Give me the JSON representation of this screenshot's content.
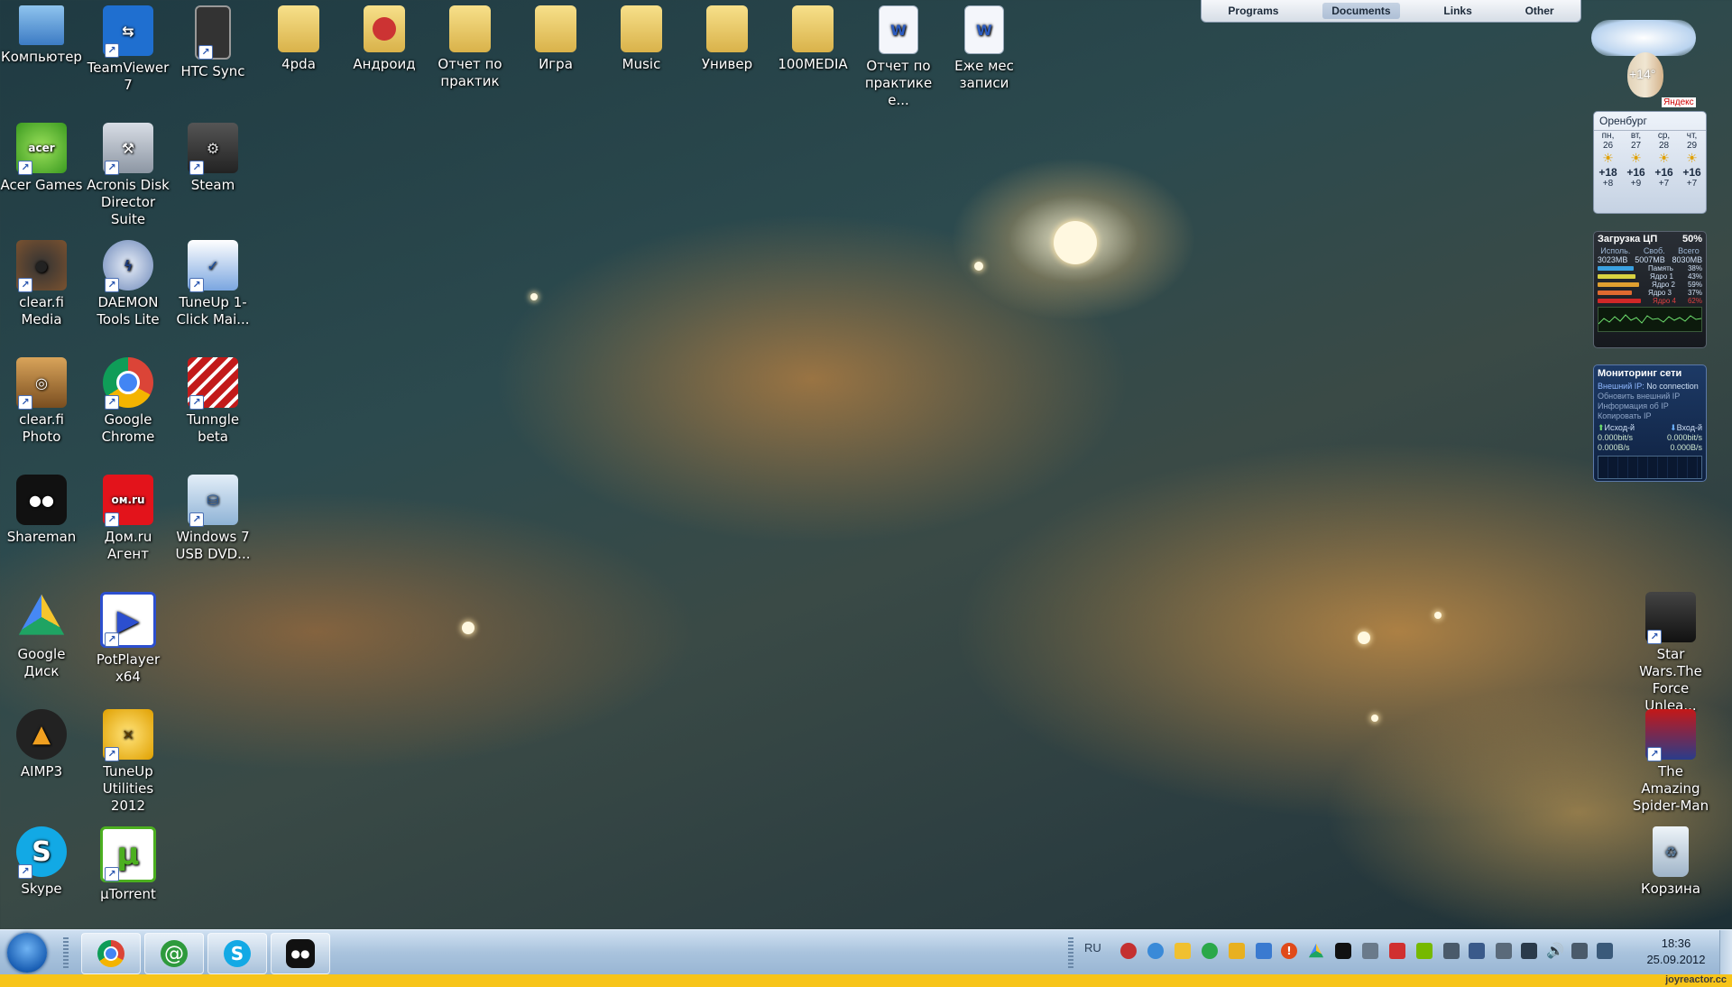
{
  "desktop_icons": {
    "computer": "Компьютер",
    "teamviewer": "TeamViewer 7",
    "htcsync": "HTC Sync",
    "fourpda": "4pda",
    "android": "Андроид",
    "report1": "Отчет по практик",
    "game": "Игра",
    "music": "Music",
    "univer": "Универ",
    "media100": "100MEDIA",
    "report2": "Отчет по практике е...",
    "monthly": "Еже мес записи",
    "acer": "Acer Games",
    "acronis": "Acronis Disk Director Suite",
    "steam": "Steam",
    "clearfimedia": "clear.fi Media",
    "daemon": "DAEMON Tools Lite",
    "tuneup1": "TuneUp 1-Click Mai...",
    "clearfiphoto": "clear.fi Photo",
    "chrome": "Google Chrome",
    "tunngle": "Tunngle beta",
    "shareman": "Shareman",
    "domru": "Дом.ru Агент",
    "win7usb": "Windows 7 USB DVD...",
    "gdisk": "Google Диск",
    "potplayer": "PotPlayer x64",
    "aimp": "AIMP3",
    "tuneup2012": "TuneUp Utilities 2012",
    "skype": "Skype",
    "utorrent": "µTorrent",
    "starwars": "Star Wars.The Force Unlea...",
    "spiderman": "The Amazing Spider-Man",
    "recycle": "Корзина"
  },
  "toolbar": {
    "items": [
      "Programs",
      "Documents",
      "Links",
      "Other"
    ],
    "active": "Documents"
  },
  "weather": {
    "temp_now": "+14°",
    "brand": "Яндекс",
    "city": "Оренбург",
    "days": [
      "пн,",
      "вт,",
      "ср,",
      "чт,"
    ],
    "dates": [
      "26",
      "27",
      "28",
      "29"
    ],
    "day_temps": [
      "+18",
      "+16",
      "+16",
      "+16"
    ],
    "night_temps": [
      "+8",
      "+9",
      "+7",
      "+7"
    ]
  },
  "cpu": {
    "title": "Загрузка ЦП",
    "percent": "50%",
    "col_used": "Исполь.",
    "col_free": "Своб.",
    "col_total": "Всего",
    "used": "3023MB",
    "free": "5007MB",
    "total": "8030MB",
    "rows": [
      {
        "label": "Память",
        "value": "38%"
      },
      {
        "label": "Ядро 1",
        "value": "43%"
      },
      {
        "label": "Ядро 2",
        "value": "59%"
      },
      {
        "label": "Ядро 3",
        "value": "37%"
      },
      {
        "label": "Ядро 4",
        "value": "62%"
      }
    ]
  },
  "net": {
    "title": "Мониторинг сети",
    "ip_label": "Внешний IP:",
    "ip_value": "No connection",
    "refresh": "Обновить внешний IP",
    "info": "Информация об IP",
    "copy": "Копировать IP",
    "out_label": "Исход-й",
    "in_label": "Вход-й",
    "out_bits": "0.000bit/s",
    "in_bits": "0.000bit/s",
    "out_bytes": "0.000B/s",
    "in_bytes": "0.000B/s"
  },
  "taskbar": {
    "lang": "RU",
    "time": "18:36",
    "date": "25.09.2012"
  },
  "watermark": "joyreactor.cc"
}
